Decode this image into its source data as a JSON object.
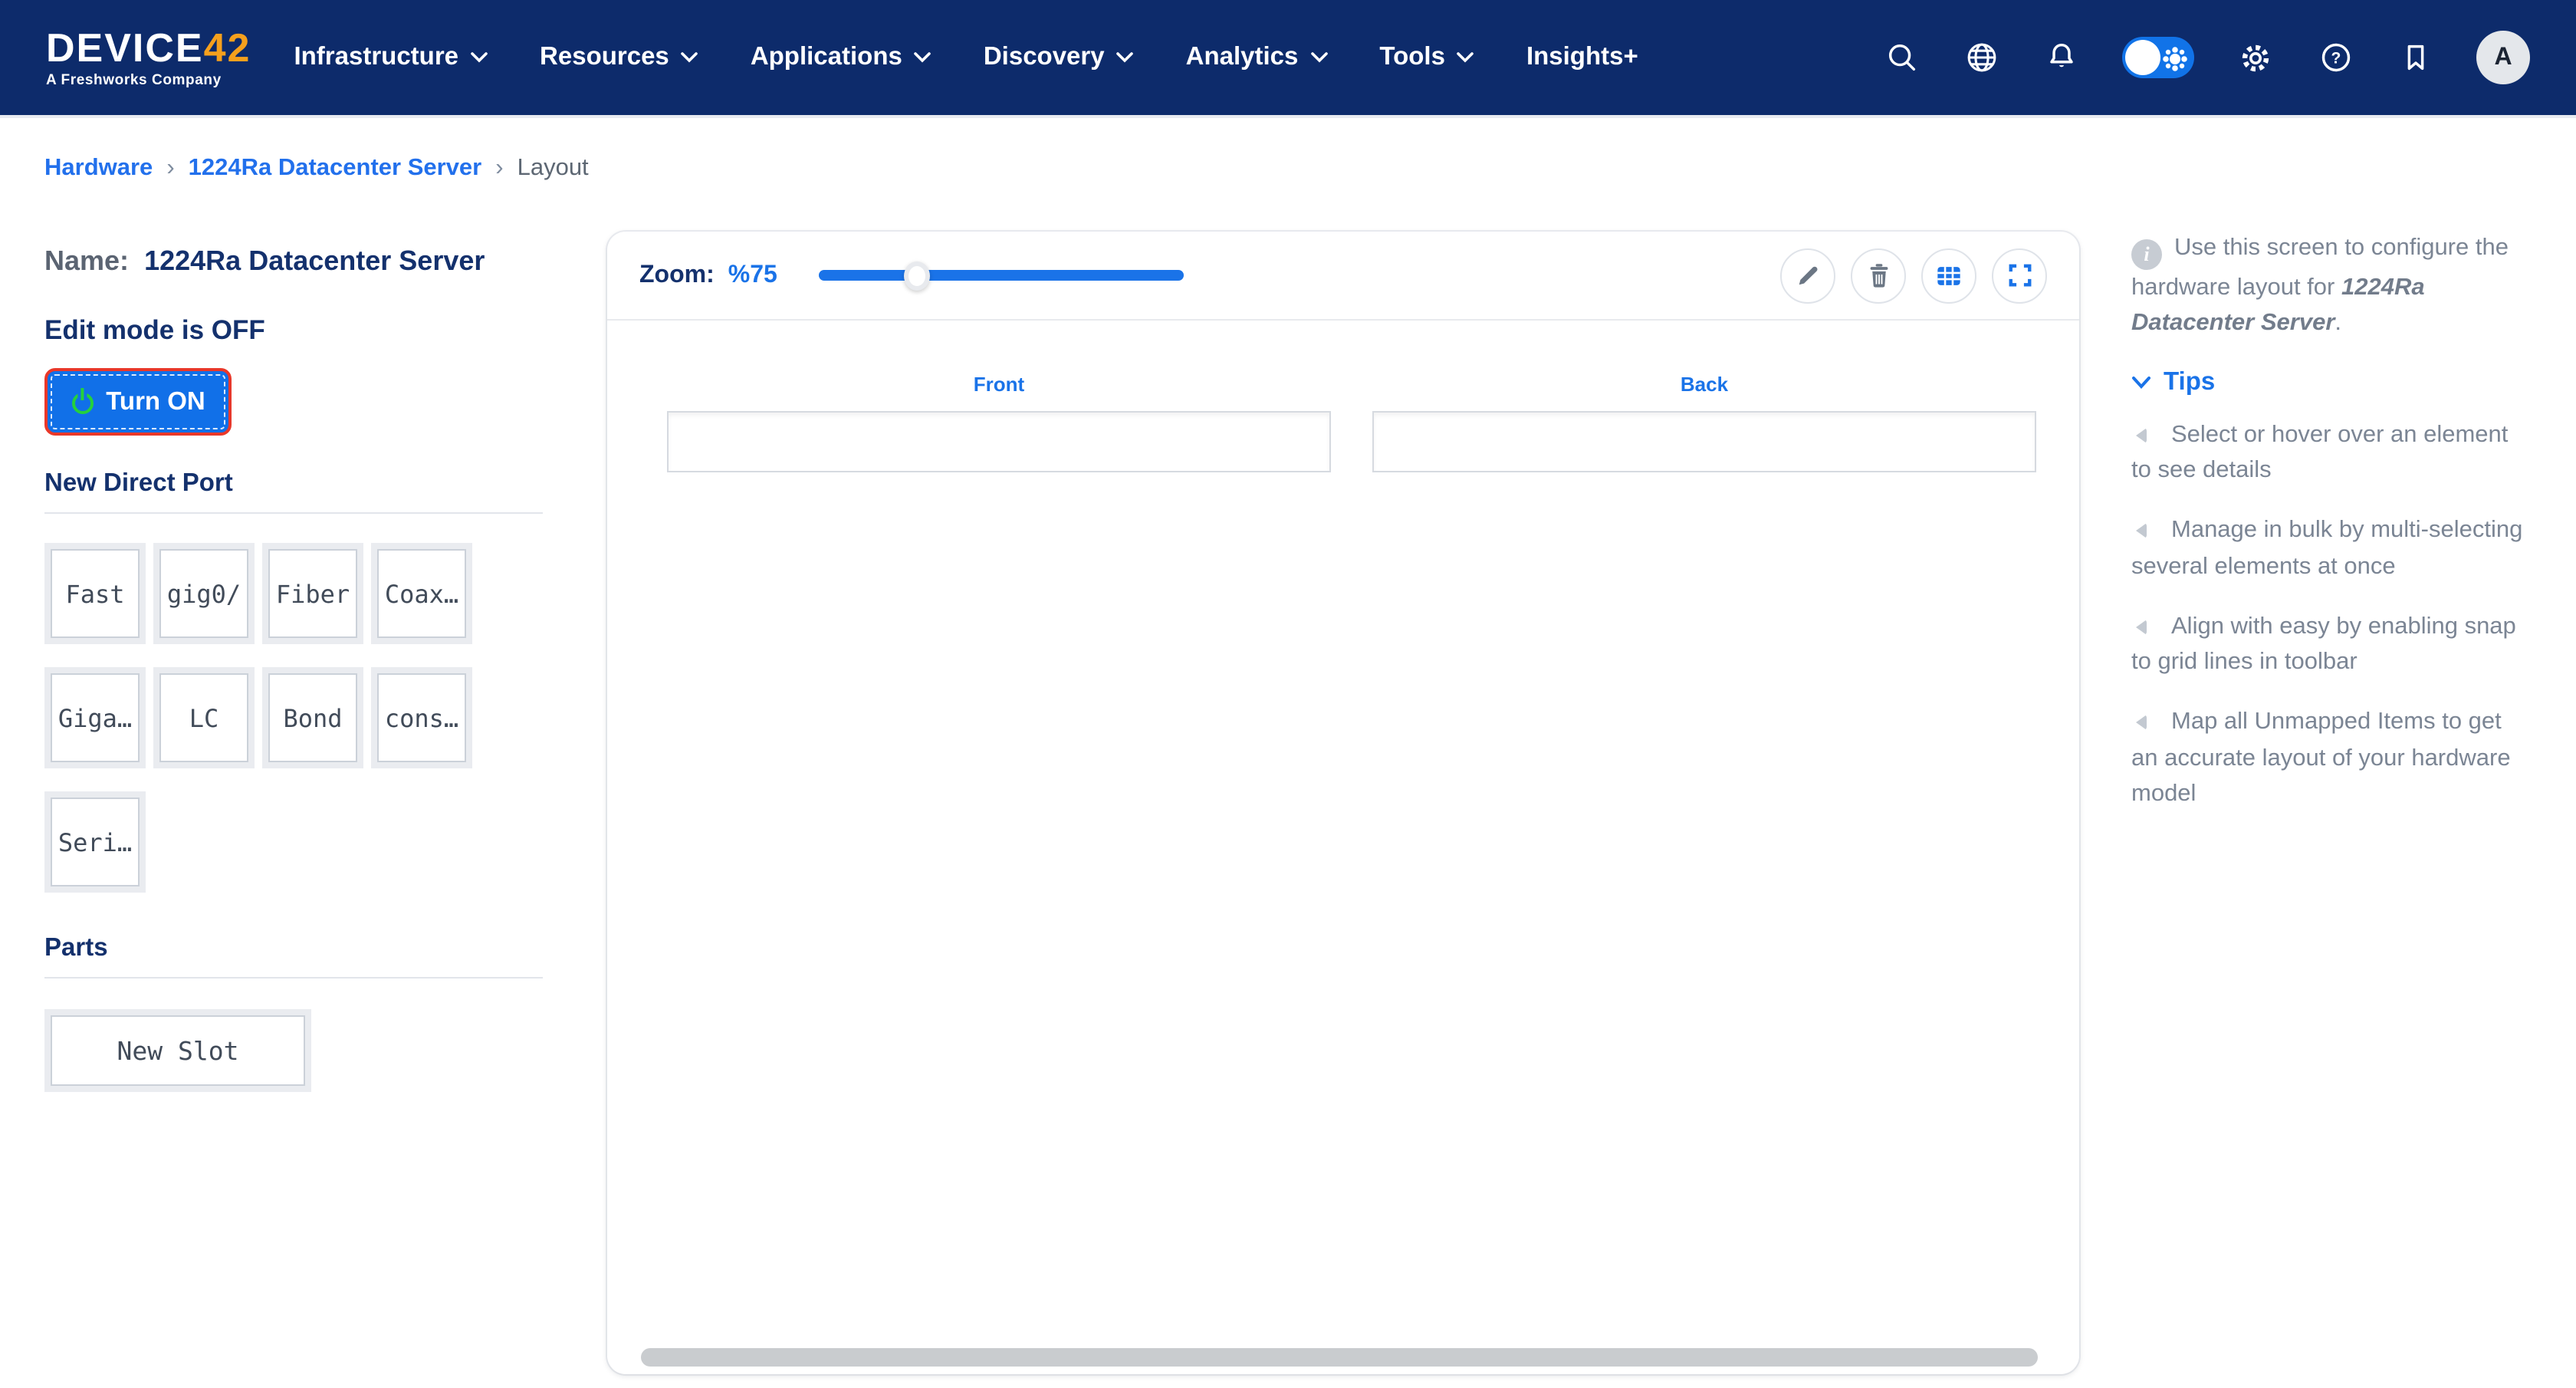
{
  "nav": {
    "brand": {
      "name": "DEVICE",
      "accent": "42",
      "tagline": "A Freshworks Company"
    },
    "menu": [
      {
        "label": "Infrastructure"
      },
      {
        "label": "Resources"
      },
      {
        "label": "Applications"
      },
      {
        "label": "Discovery"
      },
      {
        "label": "Analytics"
      },
      {
        "label": "Tools"
      },
      {
        "label": "Insights+"
      }
    ],
    "avatar_initial": "A"
  },
  "breadcrumb": {
    "sep": "›",
    "items": [
      {
        "label": "Hardware"
      },
      {
        "label": "1224Ra Datacenter Server"
      },
      {
        "label": "Layout"
      }
    ]
  },
  "left_panel": {
    "name_label": "Name:",
    "name_value": "1224Ra Datacenter Server",
    "edit_mode_text": "Edit mode is OFF",
    "turn_on_label": "Turn ON",
    "direct_port_heading": "New Direct Port",
    "port_tiles": [
      "Fast",
      "gig0/",
      "Fiber",
      "Coax…",
      "Giga…",
      "LC",
      "Bond",
      "cons…",
      "Seri…"
    ],
    "parts_heading": "Parts",
    "new_slot_label": "New Slot"
  },
  "canvas": {
    "zoom_label": "Zoom:",
    "zoom_value": "%75",
    "slider_percent": 27,
    "front_label": "Front",
    "back_label": "Back",
    "toolbar_icons": [
      "edit",
      "delete",
      "grid",
      "fullscreen"
    ]
  },
  "tips_panel": {
    "intro_prefix": "Use this screen to configure the hardware layout for ",
    "intro_emphasis": "1224Ra Datacenter Server",
    "intro_suffix": ".",
    "tips_heading": "Tips",
    "tips": [
      "Select or hover over an element to see details",
      "Manage in bulk by multi-selecting several elements at once",
      "Align with easy by enabling snap to grid lines in toolbar",
      "Map all Unmapped Items to get an accurate layout of your hardware model"
    ]
  },
  "colors": {
    "nav_navy": "#0d2b6b",
    "link_blue": "#1a73e8",
    "heading_navy": "#14316d",
    "button_blue": "#1170e8",
    "alert_red": "#ea3829",
    "power_green": "#25d13c",
    "muted_text": "#7b8594"
  }
}
